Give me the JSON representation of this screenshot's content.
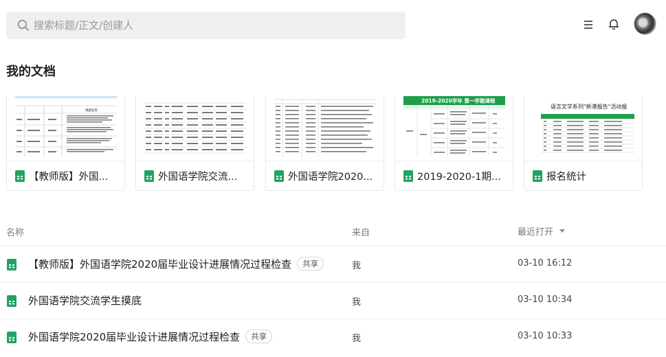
{
  "search": {
    "placeholder": "搜索标题/正文/创建人"
  },
  "header_icons": [
    "search-icon",
    "menu-list-icon",
    "bell-icon",
    "avatar"
  ],
  "section_title": "我的文档",
  "cards": [
    {
      "title": "【教师版】外国...",
      "thumb_heading": "课题名称"
    },
    {
      "title": "外国语学院交流..."
    },
    {
      "title": "外国语学院2020..."
    },
    {
      "title": "2019-2020-1期...",
      "thumb_heading": "2019-2020学年 第一学期课程"
    },
    {
      "title": "报名统计",
      "thumb_heading": "语言文学系列\"新港报告\"活动报"
    }
  ],
  "list": {
    "headers": {
      "name": "名称",
      "from": "来自",
      "last_opened": "最近打开"
    },
    "rows": [
      {
        "name": "【教师版】外国语学院2020届毕业设计进展情况过程检查",
        "badge": "共享",
        "from": "我",
        "time": "03-10 16:12"
      },
      {
        "name": "外国语学院交流学生摸底",
        "badge": "",
        "from": "我",
        "time": "03-10 10:34"
      },
      {
        "name": "外国语学院2020届毕业设计进展情况过程检查",
        "badge": "共享",
        "from": "我",
        "time": "03-10 10:33"
      }
    ]
  },
  "colors": {
    "sheet_green": "#21a366",
    "thumb_green": "#1e9e4a",
    "search_bg": "#efefef"
  }
}
